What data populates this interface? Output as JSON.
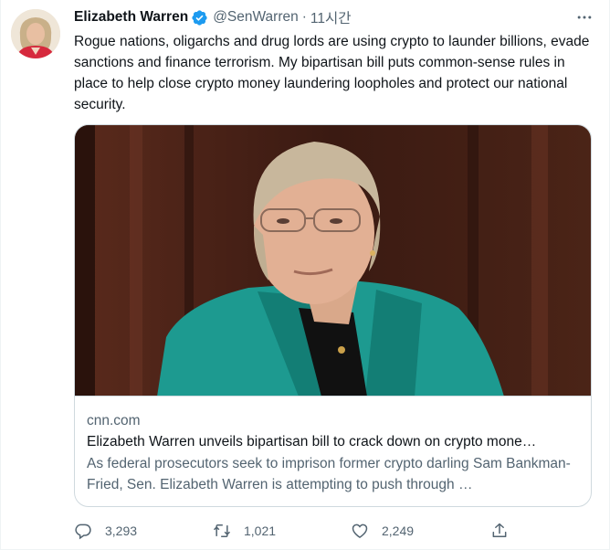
{
  "tweet": {
    "author_name": "Elizabeth Warren",
    "handle": "@SenWarren",
    "separator": "·",
    "time": "11시간",
    "text": "Rogue nations, oligarchs and drug lords are using crypto to launder billions, evade sanctions and finance terrorism. My bipartisan bill puts common-sense rules in place to help close crypto money laundering loopholes and protect our national security."
  },
  "card": {
    "domain": "cnn.com",
    "title": "Elizabeth Warren unveils bipartisan bill to crack down on crypto mone…",
    "description": "As federal prosecutors seek to imprison former crypto darling Sam Bankman-Fried, Sen. Elizabeth Warren is attempting to push through …"
  },
  "actions": {
    "reply_count": "3,293",
    "retweet_count": "1,021",
    "like_count": "2,249"
  },
  "icons": {
    "verified": "verified-badge-icon",
    "more": "more-icon",
    "reply": "reply-icon",
    "retweet": "retweet-icon",
    "like": "heart-icon",
    "share": "share-icon"
  },
  "colors": {
    "verified": "#1d9bf0",
    "text_primary": "#0f1419",
    "text_secondary": "#536471",
    "border": "#cfd9de"
  }
}
